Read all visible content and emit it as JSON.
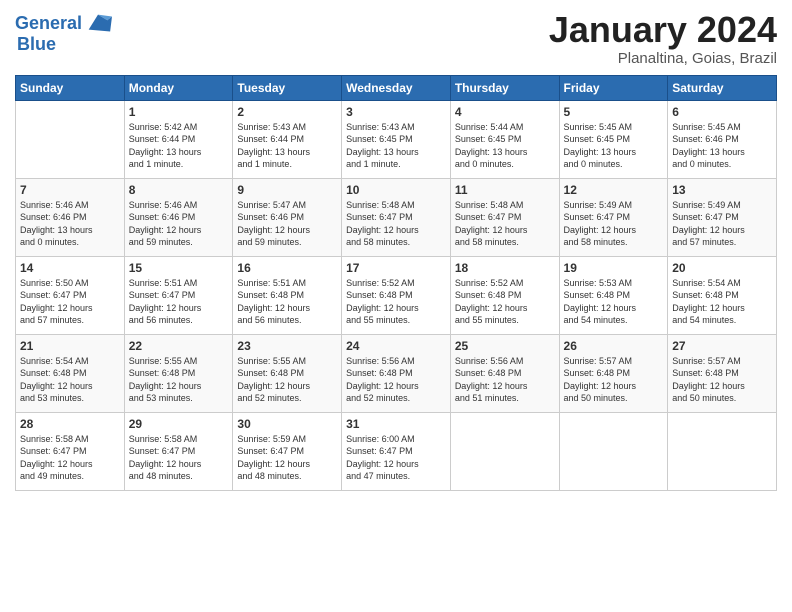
{
  "header": {
    "logo_line1": "General",
    "logo_line2": "Blue",
    "month_title": "January 2024",
    "subtitle": "Planaltina, Goias, Brazil"
  },
  "days_of_week": [
    "Sunday",
    "Monday",
    "Tuesday",
    "Wednesday",
    "Thursday",
    "Friday",
    "Saturday"
  ],
  "weeks": [
    [
      {
        "day": "",
        "info": ""
      },
      {
        "day": "1",
        "info": "Sunrise: 5:42 AM\nSunset: 6:44 PM\nDaylight: 13 hours\nand 1 minute."
      },
      {
        "day": "2",
        "info": "Sunrise: 5:43 AM\nSunset: 6:44 PM\nDaylight: 13 hours\nand 1 minute."
      },
      {
        "day": "3",
        "info": "Sunrise: 5:43 AM\nSunset: 6:45 PM\nDaylight: 13 hours\nand 1 minute."
      },
      {
        "day": "4",
        "info": "Sunrise: 5:44 AM\nSunset: 6:45 PM\nDaylight: 13 hours\nand 0 minutes."
      },
      {
        "day": "5",
        "info": "Sunrise: 5:45 AM\nSunset: 6:45 PM\nDaylight: 13 hours\nand 0 minutes."
      },
      {
        "day": "6",
        "info": "Sunrise: 5:45 AM\nSunset: 6:46 PM\nDaylight: 13 hours\nand 0 minutes."
      }
    ],
    [
      {
        "day": "7",
        "info": "Sunrise: 5:46 AM\nSunset: 6:46 PM\nDaylight: 13 hours\nand 0 minutes."
      },
      {
        "day": "8",
        "info": "Sunrise: 5:46 AM\nSunset: 6:46 PM\nDaylight: 12 hours\nand 59 minutes."
      },
      {
        "day": "9",
        "info": "Sunrise: 5:47 AM\nSunset: 6:46 PM\nDaylight: 12 hours\nand 59 minutes."
      },
      {
        "day": "10",
        "info": "Sunrise: 5:48 AM\nSunset: 6:47 PM\nDaylight: 12 hours\nand 58 minutes."
      },
      {
        "day": "11",
        "info": "Sunrise: 5:48 AM\nSunset: 6:47 PM\nDaylight: 12 hours\nand 58 minutes."
      },
      {
        "day": "12",
        "info": "Sunrise: 5:49 AM\nSunset: 6:47 PM\nDaylight: 12 hours\nand 58 minutes."
      },
      {
        "day": "13",
        "info": "Sunrise: 5:49 AM\nSunset: 6:47 PM\nDaylight: 12 hours\nand 57 minutes."
      }
    ],
    [
      {
        "day": "14",
        "info": "Sunrise: 5:50 AM\nSunset: 6:47 PM\nDaylight: 12 hours\nand 57 minutes."
      },
      {
        "day": "15",
        "info": "Sunrise: 5:51 AM\nSunset: 6:47 PM\nDaylight: 12 hours\nand 56 minutes."
      },
      {
        "day": "16",
        "info": "Sunrise: 5:51 AM\nSunset: 6:48 PM\nDaylight: 12 hours\nand 56 minutes."
      },
      {
        "day": "17",
        "info": "Sunrise: 5:52 AM\nSunset: 6:48 PM\nDaylight: 12 hours\nand 55 minutes."
      },
      {
        "day": "18",
        "info": "Sunrise: 5:52 AM\nSunset: 6:48 PM\nDaylight: 12 hours\nand 55 minutes."
      },
      {
        "day": "19",
        "info": "Sunrise: 5:53 AM\nSunset: 6:48 PM\nDaylight: 12 hours\nand 54 minutes."
      },
      {
        "day": "20",
        "info": "Sunrise: 5:54 AM\nSunset: 6:48 PM\nDaylight: 12 hours\nand 54 minutes."
      }
    ],
    [
      {
        "day": "21",
        "info": "Sunrise: 5:54 AM\nSunset: 6:48 PM\nDaylight: 12 hours\nand 53 minutes."
      },
      {
        "day": "22",
        "info": "Sunrise: 5:55 AM\nSunset: 6:48 PM\nDaylight: 12 hours\nand 53 minutes."
      },
      {
        "day": "23",
        "info": "Sunrise: 5:55 AM\nSunset: 6:48 PM\nDaylight: 12 hours\nand 52 minutes."
      },
      {
        "day": "24",
        "info": "Sunrise: 5:56 AM\nSunset: 6:48 PM\nDaylight: 12 hours\nand 52 minutes."
      },
      {
        "day": "25",
        "info": "Sunrise: 5:56 AM\nSunset: 6:48 PM\nDaylight: 12 hours\nand 51 minutes."
      },
      {
        "day": "26",
        "info": "Sunrise: 5:57 AM\nSunset: 6:48 PM\nDaylight: 12 hours\nand 50 minutes."
      },
      {
        "day": "27",
        "info": "Sunrise: 5:57 AM\nSunset: 6:48 PM\nDaylight: 12 hours\nand 50 minutes."
      }
    ],
    [
      {
        "day": "28",
        "info": "Sunrise: 5:58 AM\nSunset: 6:47 PM\nDaylight: 12 hours\nand 49 minutes."
      },
      {
        "day": "29",
        "info": "Sunrise: 5:58 AM\nSunset: 6:47 PM\nDaylight: 12 hours\nand 48 minutes."
      },
      {
        "day": "30",
        "info": "Sunrise: 5:59 AM\nSunset: 6:47 PM\nDaylight: 12 hours\nand 48 minutes."
      },
      {
        "day": "31",
        "info": "Sunrise: 6:00 AM\nSunset: 6:47 PM\nDaylight: 12 hours\nand 47 minutes."
      },
      {
        "day": "",
        "info": ""
      },
      {
        "day": "",
        "info": ""
      },
      {
        "day": "",
        "info": ""
      }
    ]
  ]
}
